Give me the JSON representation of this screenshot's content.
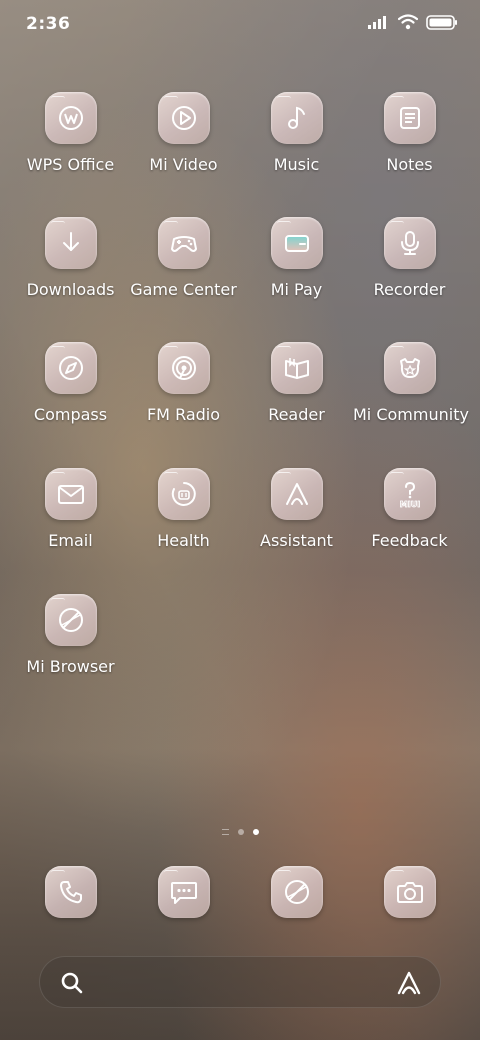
{
  "status_bar": {
    "time": "2:36",
    "icons": [
      "signal-icon",
      "wifi-icon",
      "battery-icon"
    ]
  },
  "apps": [
    {
      "label": "WPS Office",
      "icon": "wps-office-icon"
    },
    {
      "label": "Mi Video",
      "icon": "play-icon"
    },
    {
      "label": "Music",
      "icon": "music-note-icon"
    },
    {
      "label": "Notes",
      "icon": "notes-icon"
    },
    {
      "label": "Downloads",
      "icon": "download-icon"
    },
    {
      "label": "Game Center",
      "icon": "gamepad-icon"
    },
    {
      "label": "Mi Pay",
      "icon": "wallet-icon"
    },
    {
      "label": "Recorder",
      "icon": "microphone-icon"
    },
    {
      "label": "Compass",
      "icon": "compass-icon"
    },
    {
      "label": "FM Radio",
      "icon": "radio-icon"
    },
    {
      "label": "Reader",
      "icon": "book-icon"
    },
    {
      "label": "Mi Community",
      "icon": "community-icon"
    },
    {
      "label": "Email",
      "icon": "envelope-icon"
    },
    {
      "label": "Health",
      "icon": "health-icon"
    },
    {
      "label": "Assistant",
      "icon": "assistant-icon"
    },
    {
      "label": "Feedback",
      "icon": "feedback-icon"
    },
    {
      "label": "Mi Browser",
      "icon": "browser-icon"
    }
  ],
  "dock": [
    {
      "icon": "phone-icon"
    },
    {
      "icon": "message-icon"
    },
    {
      "icon": "browser-icon"
    },
    {
      "icon": "camera-icon"
    }
  ],
  "page_indicator": {
    "pages": 3,
    "current": 3
  },
  "colors": {
    "icon_stroke": "#ffffff",
    "tile": "#e2cfcc",
    "accent_teal": "#7fd4d0"
  }
}
